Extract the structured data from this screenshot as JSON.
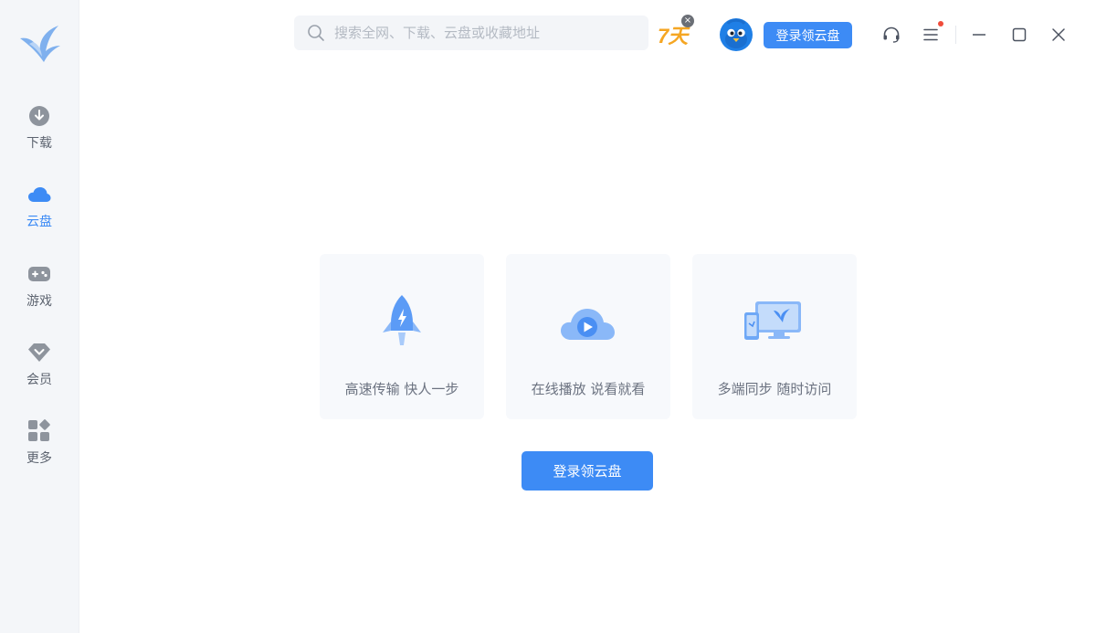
{
  "search": {
    "placeholder": "搜索全网、下载、云盘或收藏地址"
  },
  "promo": {
    "badge_text": "7天"
  },
  "header": {
    "login_button": "登录领云盘"
  },
  "sidebar": {
    "items": [
      {
        "label": "下载",
        "icon": "download-icon"
      },
      {
        "label": "云盘",
        "icon": "cloud-icon",
        "active": true
      },
      {
        "label": "游戏",
        "icon": "gamepad-icon"
      },
      {
        "label": "会员",
        "icon": "diamond-icon"
      },
      {
        "label": "更多",
        "icon": "apps-icon"
      }
    ]
  },
  "features": [
    {
      "text": "高速传输 快人一步",
      "icon": "rocket-icon"
    },
    {
      "text": "在线播放 说看就看",
      "icon": "cloud-play-icon"
    },
    {
      "text": "多端同步 随时访问",
      "icon": "devices-icon"
    }
  ],
  "main": {
    "login_button": "登录领云盘"
  },
  "colors": {
    "accent": "#3d8bf5",
    "sidebar_bg": "#f4f6f9",
    "promo": "#f5a623"
  }
}
